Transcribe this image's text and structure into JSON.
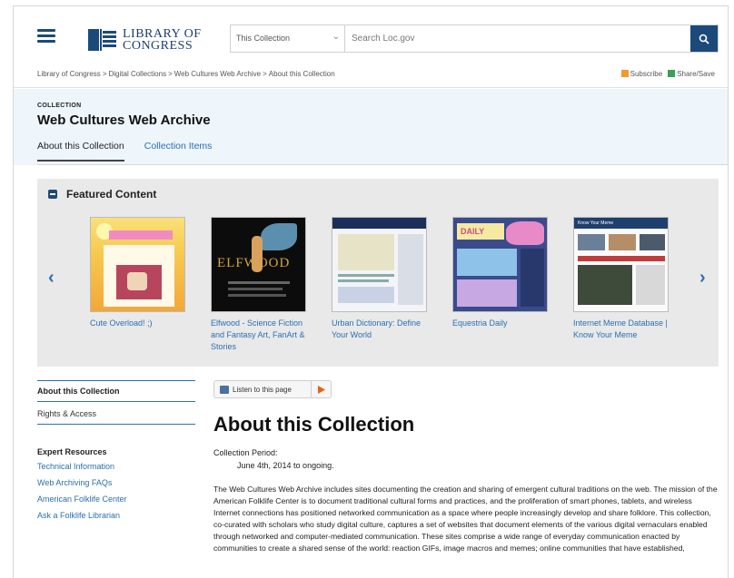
{
  "header": {
    "logo_line1": "LIBRARY OF",
    "logo_line2": "CONGRESS",
    "search_scope": "This Collection",
    "search_placeholder": "Search Loc.gov"
  },
  "breadcrumb": [
    "Library of Congress",
    "Digital Collections",
    "Web Cultures Web Archive",
    "About this Collection"
  ],
  "actions": {
    "subscribe": "Subscribe",
    "share": "Share/Save"
  },
  "collection": {
    "eyebrow": "COLLECTION",
    "title": "Web Cultures Web Archive",
    "tabs": [
      {
        "label": "About this Collection",
        "active": true
      },
      {
        "label": "Collection Items",
        "active": false
      }
    ]
  },
  "featured": {
    "title": "Featured Content",
    "items": [
      {
        "caption": "Cute Overload! ;)",
        "thumb": "cute-overload"
      },
      {
        "caption": "Elfwood - Science Fiction and Fantasy Art, FanArt & Stories",
        "thumb": "elfwood",
        "thumb_text": "ELFWOOD"
      },
      {
        "caption": "Urban Dictionary: Define Your World",
        "thumb": "urban-dictionary"
      },
      {
        "caption": "Equestria Daily",
        "thumb": "equestria-daily",
        "thumb_text": "DAILY"
      },
      {
        "caption": "Internet Meme Database | Know Your Meme",
        "thumb": "know-your-meme",
        "thumb_text": "Know Your Meme"
      }
    ]
  },
  "sidebar": {
    "items": [
      "About this Collection",
      "Rights & Access"
    ],
    "expert_heading": "Expert Resources",
    "expert_links": [
      "Technical Information",
      "Web Archiving FAQs",
      "American Folklife Center",
      "Ask a Folklife Librarian"
    ]
  },
  "main": {
    "listen_label": "Listen to this page",
    "title": "About this Collection",
    "period_label": "Collection Period:",
    "period_value": "June 4th, 2014 to ongoing.",
    "body": "The Web Cultures Web Archive includes sites documenting the creation and sharing of emergent cultural traditions on the web. The mission of the American Folklife Center is to document traditional cultural forms and practices, and the proliferation of smart phones, tablets, and wireless Internet connections has positioned networked communication as a space where people increasingly develop and share folklore. This collection, co-curated with scholars who study digital culture, captures a set of websites that document elements of the various digital vernaculars enabled through networked and computer-mediated communication. These sites comprise a wide range of everyday communication enacted by communities to create a shared sense of the world: reaction GIFs, image macros and memes; online communities that have established,"
  },
  "colors": {
    "brand": "#1b4a7a",
    "link": "#2a6fb0",
    "header_bg": "#eef5fb",
    "featured_bg": "#e9e9e9"
  }
}
